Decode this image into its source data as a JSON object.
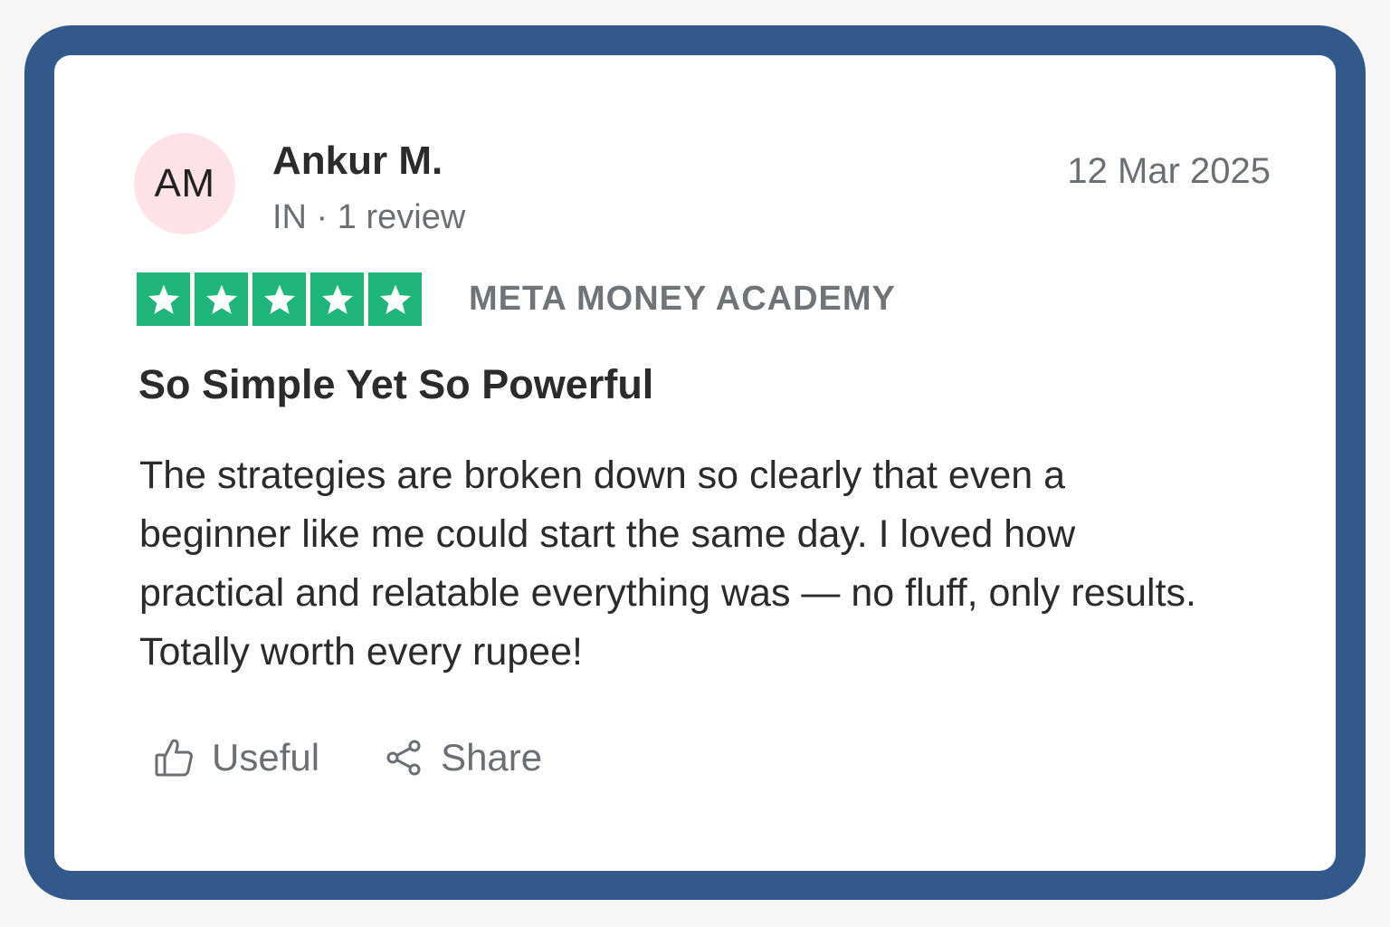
{
  "review": {
    "avatar_initials": "AM",
    "reviewer_name": "Ankur M.",
    "reviewer_meta": "IN · 1 review",
    "date": "12 Mar 2025",
    "rating": 5,
    "rating_max": 5,
    "company": "META MONEY ACADEMY",
    "title": "So Simple Yet So Powerful",
    "body": "The strategies are broken down so clearly that even a beginner like me could start the same day. I loved how practical and relatable everything was — no fluff, only results. Totally worth every rupee!"
  },
  "actions": {
    "useful_label": "Useful",
    "useful_icon": "thumbs-up-icon",
    "share_label": "Share",
    "share_icon": "share-icon"
  },
  "colors": {
    "frame": "#33588a",
    "avatar_bg": "#fde3e8",
    "star_bg": "#1fb47a",
    "muted_text": "#6b6f73"
  }
}
